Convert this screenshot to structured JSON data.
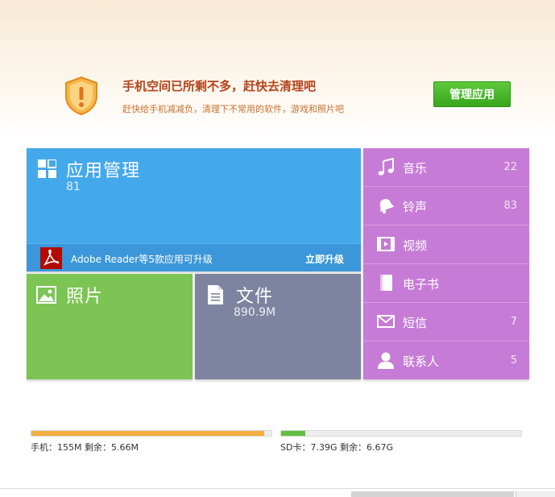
{
  "alert": {
    "title": "手机空间已所剩不多，赶快去清理吧",
    "subtitle": "赶快给手机减减负，清理下不常用的软件，游戏和照片吧",
    "button_label": "管理应用",
    "icon": "shield-warning-icon"
  },
  "tiles": {
    "apps": {
      "title": "应用管理",
      "count": "81",
      "upgrade_text": "Adobe Reader等5款应用可升级",
      "upgrade_link": "立即升级",
      "color": "#44a9ea"
    },
    "photos": {
      "title": "照片",
      "color": "#7cc453"
    },
    "files": {
      "title": "文件",
      "size": "890.9M",
      "color": "#7e849f"
    }
  },
  "sidebar": {
    "color": "#c67bd6",
    "items": [
      {
        "label": "音乐",
        "count": "22",
        "icon": "music-note-icon"
      },
      {
        "label": "铃声",
        "count": "83",
        "icon": "bell-icon"
      },
      {
        "label": "视频",
        "count": "",
        "icon": "film-icon"
      },
      {
        "label": "电子书",
        "count": "",
        "icon": "book-icon"
      },
      {
        "label": "短信",
        "count": "7",
        "icon": "envelope-icon"
      },
      {
        "label": "联系人",
        "count": "5",
        "icon": "person-icon"
      }
    ]
  },
  "storage": {
    "phone": {
      "text": "手机：155M    剩余：5.66M",
      "used_fraction": 0.97,
      "color": "#f4ad42"
    },
    "sd": {
      "text": "SD卡：7.39G    剩余：6.67G",
      "used_fraction": 0.1,
      "color": "#5fbf3d"
    }
  }
}
